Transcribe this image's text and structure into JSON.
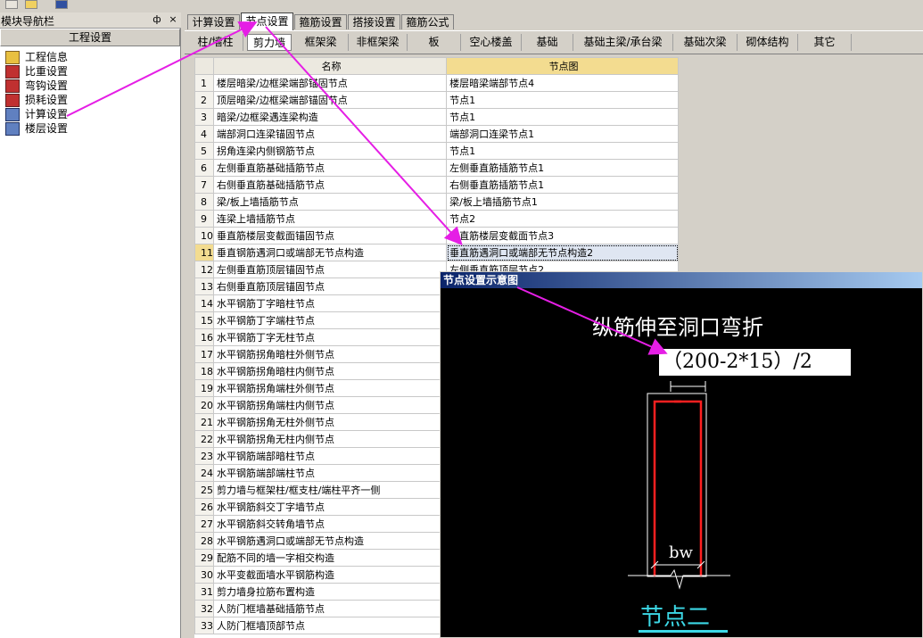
{
  "nav": {
    "title": "模块导航栏",
    "pin": "ф",
    "close": "×",
    "header": "工程设置",
    "items": [
      {
        "label": "工程信息",
        "icon": "project-info-icon"
      },
      {
        "label": "比重设置",
        "icon": "density-icon"
      },
      {
        "label": "弯钩设置",
        "icon": "hook-icon"
      },
      {
        "label": "损耗设置",
        "icon": "loss-icon"
      },
      {
        "label": "计算设置",
        "icon": "calc-settings-icon"
      },
      {
        "label": "楼层设置",
        "icon": "floor-icon"
      }
    ]
  },
  "tabs": [
    "计算设置",
    "节点设置",
    "箍筋设置",
    "搭接设置",
    "箍筋公式"
  ],
  "active_tab": 1,
  "subtabs": [
    "柱/墙柱",
    "剪力墙",
    "框架梁",
    "非框架梁",
    "板",
    "空心楼盖",
    "基础",
    "基础主梁/承台梁",
    "基础次梁",
    "砌体结构",
    "其它"
  ],
  "active_subtab": 1,
  "grid": {
    "col_name": "名称",
    "col_node": "节点图",
    "selected_row": 11,
    "rows": [
      {
        "n": "1",
        "name": "楼层暗梁/边框梁端部锚固节点",
        "val": "楼层暗梁端部节点4"
      },
      {
        "n": "2",
        "name": "顶层暗梁/边框梁端部锚固节点",
        "val": "节点1"
      },
      {
        "n": "3",
        "name": "暗梁/边框梁遇连梁构造",
        "val": "节点1"
      },
      {
        "n": "4",
        "name": "端部洞口连梁锚固节点",
        "val": "端部洞口连梁节点1"
      },
      {
        "n": "5",
        "name": "拐角连梁内侧钢筋节点",
        "val": "节点1"
      },
      {
        "n": "6",
        "name": "左侧垂直筋基础插筋节点",
        "val": "左侧垂直筋插筋节点1"
      },
      {
        "n": "7",
        "name": "右侧垂直筋基础插筋节点",
        "val": "右侧垂直筋插筋节点1"
      },
      {
        "n": "8",
        "name": "梁/板上墙插筋节点",
        "val": "梁/板上墙插筋节点1"
      },
      {
        "n": "9",
        "name": "连梁上墙插筋节点",
        "val": "节点2"
      },
      {
        "n": "10",
        "name": "垂直筋楼层变截面锚固节点",
        "val": "垂直筋楼层变截面节点3"
      },
      {
        "n": "11",
        "name": "垂直钢筋遇洞口或端部无节点构造",
        "val": "垂直筋遇洞口或端部无节点构造2"
      },
      {
        "n": "12",
        "name": "左侧垂直筋顶层锚固节点",
        "val": "左侧垂直筋顶层节点2"
      },
      {
        "n": "13",
        "name": "右侧垂直筋顶层锚固节点",
        "val": ""
      },
      {
        "n": "14",
        "name": "水平钢筋丁字暗柱节点",
        "val": ""
      },
      {
        "n": "15",
        "name": "水平钢筋丁字端柱节点",
        "val": ""
      },
      {
        "n": "16",
        "name": "水平钢筋丁字无柱节点",
        "val": ""
      },
      {
        "n": "17",
        "name": "水平钢筋拐角暗柱外侧节点",
        "val": ""
      },
      {
        "n": "18",
        "name": "水平钢筋拐角暗柱内侧节点",
        "val": ""
      },
      {
        "n": "19",
        "name": "水平钢筋拐角端柱外侧节点",
        "val": ""
      },
      {
        "n": "20",
        "name": "水平钢筋拐角端柱内侧节点",
        "val": ""
      },
      {
        "n": "21",
        "name": "水平钢筋拐角无柱外侧节点",
        "val": ""
      },
      {
        "n": "22",
        "name": "水平钢筋拐角无柱内侧节点",
        "val": ""
      },
      {
        "n": "23",
        "name": "水平钢筋端部暗柱节点",
        "val": ""
      },
      {
        "n": "24",
        "name": "水平钢筋端部端柱节点",
        "val": ""
      },
      {
        "n": "25",
        "name": "剪力墙与框架柱/框支柱/端柱平齐一侧",
        "val": ""
      },
      {
        "n": "26",
        "name": "水平钢筋斜交丁字墙节点",
        "val": ""
      },
      {
        "n": "27",
        "name": "水平钢筋斜交转角墙节点",
        "val": ""
      },
      {
        "n": "28",
        "name": "水平钢筋遇洞口或端部无节点构造",
        "val": ""
      },
      {
        "n": "29",
        "name": "配筋不同的墙一字相交构造",
        "val": ""
      },
      {
        "n": "30",
        "name": "水平变截面墙水平钢筋构造",
        "val": ""
      },
      {
        "n": "31",
        "name": "剪力墙身拉筋布置构造",
        "val": ""
      },
      {
        "n": "32",
        "name": "人防门框墙基础插筋节点",
        "val": ""
      },
      {
        "n": "33",
        "name": "人防门框墙顶部节点",
        "val": ""
      }
    ]
  },
  "popup": {
    "title": "节点设置示意图",
    "caption": "纵筋伸至洞口弯折",
    "formula": "（200-2*15）/2",
    "bw": "bw",
    "node_label": "节点二"
  },
  "colors": {
    "arrow": "#e51ee5",
    "rebar": "#ff2020",
    "node_label": "#3cd8e6",
    "popup_title_start": "#0a246a",
    "header_highlight": "#f3dc90"
  }
}
